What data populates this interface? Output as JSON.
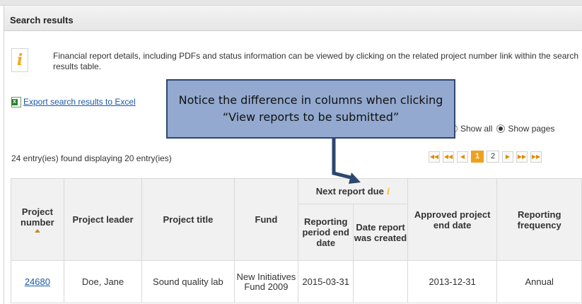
{
  "panel": {
    "title": "Search results"
  },
  "info": {
    "icon": "info-icon",
    "text": "Financial report details, including PDFs and status information can be viewed by clicking on the related project number link within the search results table."
  },
  "export": {
    "icon": "excel-icon",
    "label": "Export search results to Excel"
  },
  "view_options": {
    "show_all": "Show all",
    "show_pages": "Show pages",
    "selected": "Show pages"
  },
  "results": {
    "count_text": "24 entry(ies) found displaying 20 entry(ies)"
  },
  "pager": {
    "pages": [
      "1",
      "2"
    ],
    "current": "1"
  },
  "table": {
    "group_header": "Next report due",
    "headers": {
      "project_number": "Project number",
      "project_leader": "Project leader",
      "project_title": "Project title",
      "fund": "Fund",
      "reporting_period_end": "Reporting period end date",
      "date_report_created": "Date report was created",
      "approved_end_date": "Approved project end date",
      "reporting_frequency": "Reporting frequency"
    },
    "rows": [
      {
        "project_number": "24680",
        "project_leader": "Doe, Jane",
        "project_title": "Sound quality lab",
        "fund": "New Initiatives Fund 2009",
        "reporting_period_end": "2015-03-31",
        "date_report_created": "",
        "approved_end_date": "2013-12-31",
        "reporting_frequency": "Annual"
      }
    ]
  },
  "callout": {
    "text": "Notice the difference in columns when clicking “View reports to be submitted”",
    "fill": "#93a9cf",
    "border": "#2c4770"
  },
  "colors": {
    "accent": "#f0a020",
    "link": "#1a5aa6"
  }
}
